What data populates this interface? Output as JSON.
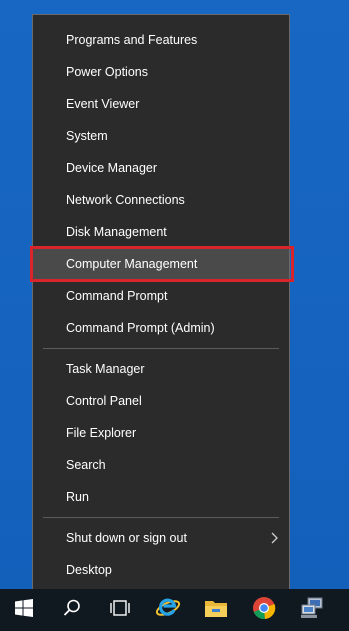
{
  "menu": {
    "items": [
      {
        "label": "Programs and Features"
      },
      {
        "label": "Power Options"
      },
      {
        "label": "Event Viewer"
      },
      {
        "label": "System"
      },
      {
        "label": "Device Manager"
      },
      {
        "label": "Network Connections"
      },
      {
        "label": "Disk Management"
      },
      {
        "label": "Computer Management"
      },
      {
        "label": "Command Prompt"
      },
      {
        "label": "Command Prompt (Admin)"
      },
      {
        "label": "Task Manager"
      },
      {
        "label": "Control Panel"
      },
      {
        "label": "File Explorer"
      },
      {
        "label": "Search"
      },
      {
        "label": "Run"
      },
      {
        "label": "Shut down or sign out"
      },
      {
        "label": "Desktop"
      }
    ],
    "highlighted_item": "Computer Management",
    "highlight_color": "#d9242b"
  },
  "taskbar": {
    "buttons": [
      {
        "icon": "windows-start-icon"
      },
      {
        "icon": "search-icon"
      },
      {
        "icon": "task-view-icon"
      },
      {
        "icon": "internet-explorer-icon"
      },
      {
        "icon": "file-explorer-icon"
      },
      {
        "icon": "chrome-icon"
      },
      {
        "icon": "network-computer-icon"
      }
    ]
  },
  "colors": {
    "desktop": "#1767c3",
    "menu_background": "#2b2b2b",
    "menu_hover": "#4a4a4a",
    "taskbar": "#101820"
  }
}
